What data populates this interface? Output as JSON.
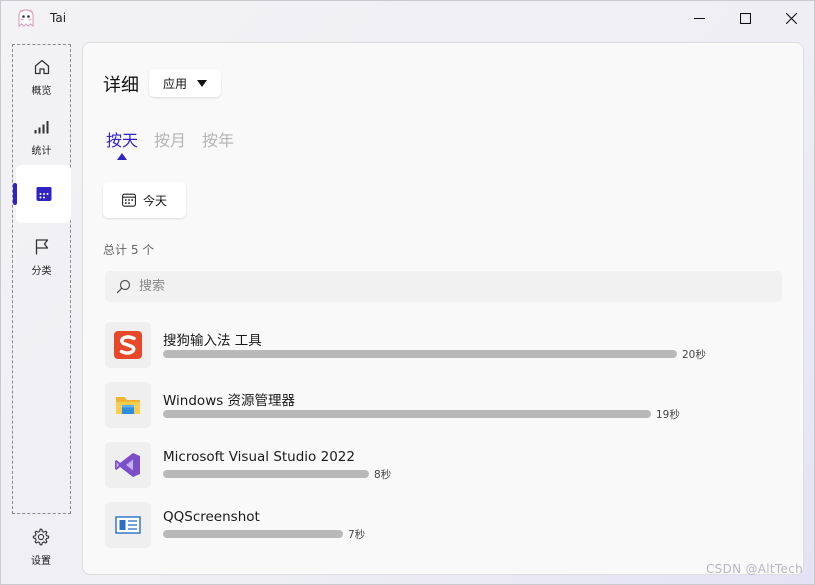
{
  "window": {
    "title": "Tai"
  },
  "sidebar": {
    "items": [
      {
        "label": "概览",
        "icon": "home-icon"
      },
      {
        "label": "统计",
        "icon": "signal-bars-icon"
      },
      {
        "label": "",
        "icon": "calendar-icon",
        "active": true
      },
      {
        "label": "分类",
        "icon": "flag-icon"
      }
    ],
    "settings": {
      "label": "设置",
      "icon": "gear-icon"
    }
  },
  "header": {
    "title": "详细",
    "dropdown_value": "应用"
  },
  "tabs": [
    {
      "label": "按天",
      "active": true
    },
    {
      "label": "按月",
      "active": false
    },
    {
      "label": "按年",
      "active": false
    }
  ],
  "today_button": {
    "label": "今天"
  },
  "total": "总计 5 个",
  "search": {
    "placeholder": "搜索",
    "value": ""
  },
  "apps": [
    {
      "name": "搜狗输入法 工具",
      "time": "20秒",
      "seconds": 20,
      "icon": "sogou-icon"
    },
    {
      "name": "Windows 资源管理器",
      "time": "19秒",
      "seconds": 19,
      "icon": "folder-icon"
    },
    {
      "name": "Microsoft Visual Studio 2022",
      "time": "8秒",
      "seconds": 8,
      "icon": "visual-studio-icon"
    },
    {
      "name": "QQScreenshot",
      "time": "7秒",
      "seconds": 7,
      "icon": "screenshot-icon"
    }
  ],
  "watermark": "CSDN @AltTech",
  "colors": {
    "accent": "#2f23c4",
    "bar": "#b9b9b9",
    "sogou": "#e8482a",
    "vs": "#7b4fc9"
  }
}
